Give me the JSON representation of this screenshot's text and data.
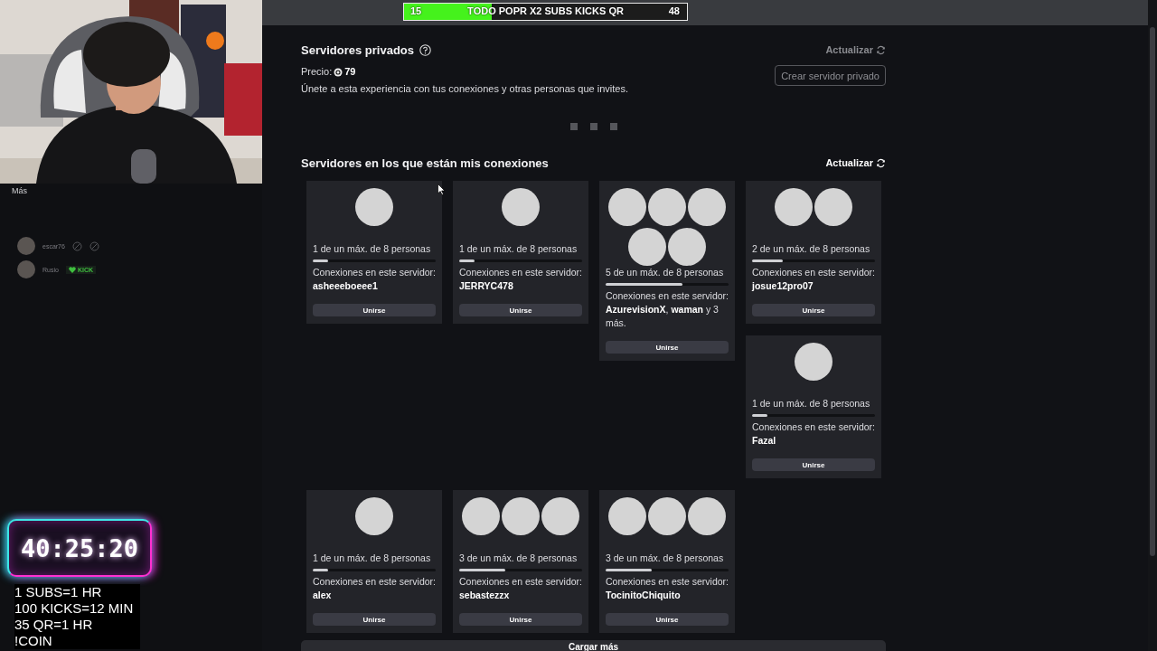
{
  "overlay": {
    "goal": {
      "start": "15",
      "label": "TODO POPR X2 SUBS KICKS QR",
      "end": "48",
      "level": 0.31
    },
    "more_label": "Más",
    "viewers": [
      {
        "name": "escar76",
        "kind": "icons"
      },
      {
        "name": "Rusio",
        "kind": "kick",
        "badge": "KICK"
      }
    ],
    "timer": "40:25:20",
    "rules": [
      "1 SUBS=1 HR",
      "100 KICKS=12 MIN",
      "35 QR=1 HR",
      "!COIN"
    ]
  },
  "private_servers": {
    "title": "Servidores privados",
    "refresh": {
      "label": "Actualizar",
      "disabled": true
    },
    "price_label": "Precio:",
    "price": "79",
    "description": "Únete a esta experiencia con tus conexiones y otras personas que invites.",
    "create_button": {
      "label": "Crear servidor privado",
      "disabled": true
    }
  },
  "friends_servers": {
    "title": "Servidores en los que están mis conexiones",
    "refresh": {
      "label": "Actualizar",
      "disabled": false
    },
    "rows": [
      {
        "columns": [
          [
            {
              "avatars": [
                {
                  "kind": "blank"
                }
              ],
              "occupancy": "1 de un máx. de 8 personas",
              "level": 0.125,
              "connections": "Conexiones en este servidor: **asheeeboeee1**",
              "button": "Unirse"
            }
          ],
          [
            {
              "avatars": [
                {
                  "kind": "blank"
                }
              ],
              "occupancy": "1 de un máx. de 8 personas",
              "level": 0.125,
              "connections": "Conexiones en este servidor: **JERRYC478**",
              "button": "Unirse"
            }
          ],
          [
            {
              "avatars": [
                {
                  "kind": "blank"
                },
                {
                  "kind": "blank"
                },
                {
                  "kind": "blank"
                },
                {
                  "kind": "blank"
                },
                {
                  "kind": "blank"
                }
              ],
              "occupancy": "5 de un máx. de 8 personas",
              "level": 0.625,
              "connections": "Conexiones en este servidor: **AzurevisionX**, **waman** y 3 más.",
              "button": "Unirse"
            }
          ],
          [
            {
              "avatars": [
                {
                  "kind": "blank"
                },
                {
                  "kind": "blank"
                }
              ],
              "occupancy": "2 de un máx. de 8 personas",
              "level": 0.25,
              "connections": "Conexiones en este servidor: **josue12pro07**",
              "button": "Unirse"
            },
            {
              "avatars": [
                {
                  "kind": "blank"
                }
              ],
              "occupancy": "1 de un máx. de 8 personas",
              "level": 0.125,
              "connections": "Conexiones en este servidor: **Fazal**",
              "button": "Unirse"
            }
          ]
        ]
      },
      {
        "columns": [
          [
            {
              "avatars": [
                {
                  "kind": "blank"
                }
              ],
              "occupancy": "1 de un máx. de 8 personas",
              "level": 0.125,
              "connections": "Conexiones en este servidor: **alex**",
              "button": "Unirse"
            }
          ],
          [
            {
              "avatars": [
                {
                  "kind": "blank"
                },
                {
                  "kind": "blank"
                },
                {
                  "kind": "blank"
                }
              ],
              "occupancy": "3 de un máx. de 8 personas",
              "level": 0.375,
              "connections": "Conexiones en este servidor: **sebastezzx**",
              "button": "Unirse"
            }
          ],
          [
            {
              "avatars": [
                {
                  "kind": "blank"
                },
                {
                  "kind": "blank"
                },
                {
                  "kind": "blank"
                }
              ],
              "occupancy": "3 de un máx. de 8 personas",
              "level": 0.375,
              "connections": "Conexiones en este servidor: **TocinitoChiquito**",
              "button": "Unirse"
            }
          ]
        ]
      }
    ],
    "load_more": "Cargar más"
  }
}
